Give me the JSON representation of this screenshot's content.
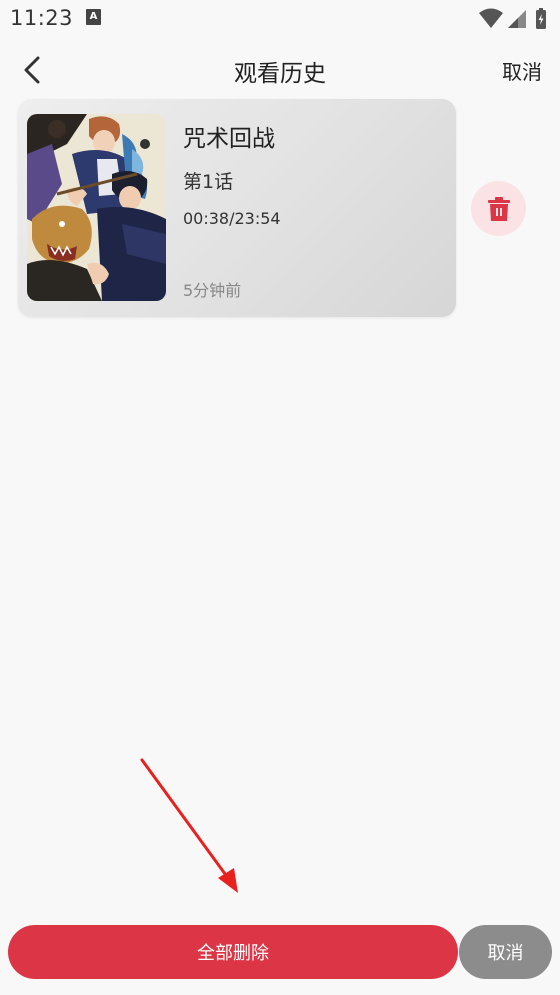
{
  "status_bar": {
    "time": "11:23",
    "notification_icon": "A"
  },
  "header": {
    "title": "观看历史",
    "cancel_label": "取消"
  },
  "history": [
    {
      "title": "咒术回战",
      "episode": "第1话",
      "progress": "00:38/23:54",
      "watched_ago": "5分钟前"
    }
  ],
  "footer": {
    "delete_all_label": "全部删除",
    "cancel_label": "取消"
  },
  "colors": {
    "accent_red": "#dc3545",
    "delete_bg": "#fbe3e5",
    "cancel_gray": "#8c8c8c"
  }
}
